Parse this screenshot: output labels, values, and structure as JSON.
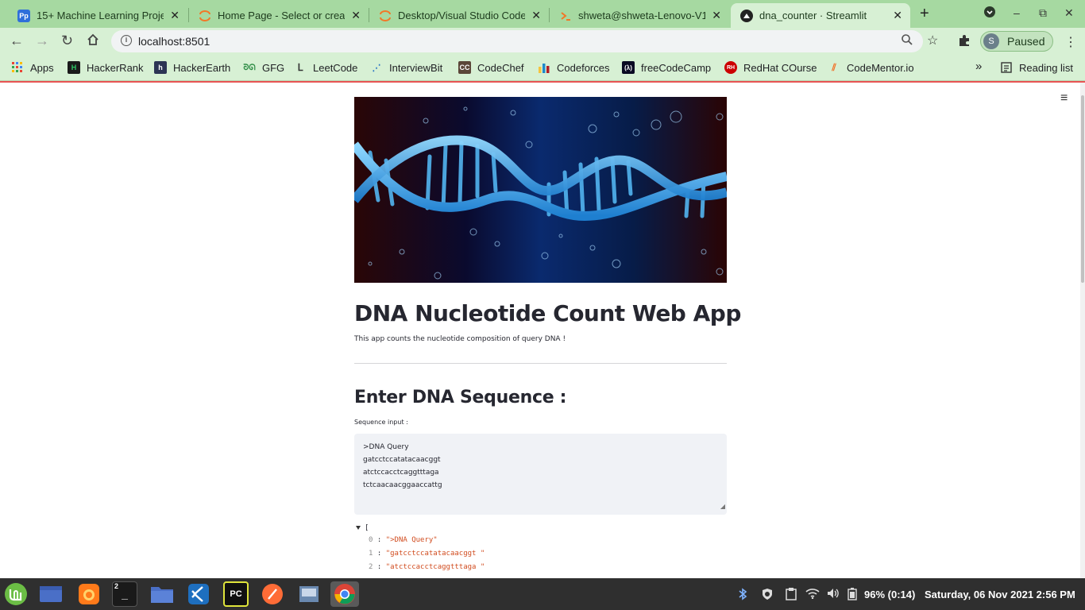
{
  "browser": {
    "tabs": [
      {
        "label": "15+ Machine Learning Proje",
        "favicon": "pp-icon",
        "favicon_text": "Pp",
        "color": "#2f6fda"
      },
      {
        "label": "Home Page - Select or creat",
        "favicon": "jupyter-icon",
        "favicon_text": "",
        "color": "#f37726"
      },
      {
        "label": "Desktop/Visual Studio Code",
        "favicon": "jupyter-icon",
        "favicon_text": "",
        "color": "#f37726"
      },
      {
        "label": "shweta@shweta-Lenovo-V1",
        "favicon": "jupyter-terminal-icon",
        "favicon_text": "",
        "color": "#f37726"
      },
      {
        "label": "dna_counter · Streamlit",
        "favicon": "streamlit-icon",
        "favicon_text": "",
        "color": "#222222"
      }
    ],
    "url": "localhost:8501",
    "profile_initial": "S",
    "profile_label": "Paused",
    "bookmarks": [
      {
        "label": "Apps",
        "icon": "apps-grid-icon"
      },
      {
        "label": "HackerRank",
        "icon": "hackerrank-icon"
      },
      {
        "label": "HackerEarth",
        "icon": "hackerearth-icon"
      },
      {
        "label": "GFG",
        "icon": "gfg-icon"
      },
      {
        "label": "LeetCode",
        "icon": "leetcode-icon"
      },
      {
        "label": "InterviewBit",
        "icon": "interviewbit-icon"
      },
      {
        "label": "CodeChef",
        "icon": "codechef-icon"
      },
      {
        "label": "Codeforces",
        "icon": "codeforces-icon"
      },
      {
        "label": "freeCodeCamp",
        "icon": "freecodecamp-icon"
      },
      {
        "label": "RedHat COurse",
        "icon": "redhat-icon"
      },
      {
        "label": "CodeMentor.io",
        "icon": "codementor-icon"
      }
    ],
    "bookmarks_overflow": "»",
    "reading_list": "Reading list"
  },
  "app": {
    "title": "DNA Nucleotide Count Web App",
    "description": "This app counts the nucleotide composition of query DNA !",
    "section_title": "Enter DNA Sequence :",
    "input_label": "Sequence input :",
    "sequence_lines": [
      ">DNA Query",
      "gatcctccatatacaacggt",
      "atctccacctcaggtttaga",
      "tctcaacaacggaaccattg"
    ],
    "json_bracket": "[",
    "json_items": [
      {
        "index": "0",
        "value": "\">DNA Query\""
      },
      {
        "index": "1",
        "value": "\"gatcctccatatacaacggt \""
      },
      {
        "index": "2",
        "value": "\"atctccacctcaggtttaga \""
      }
    ]
  },
  "taskbar": {
    "apps": [
      {
        "name": "mint-menu-icon",
        "label": "",
        "color": "#6bbd45"
      },
      {
        "name": "show-desktop-icon",
        "label": "",
        "color": "#4a6fc7"
      },
      {
        "name": "firefox-icon",
        "label": "",
        "color": "#ff7a1a"
      },
      {
        "name": "terminal-icon",
        "label": "2",
        "color": "#1a1a1a"
      },
      {
        "name": "files-icon",
        "label": "",
        "color": "#4a6fc7"
      },
      {
        "name": "vscode-icon",
        "label": "",
        "color": "#1e6fbf"
      },
      {
        "name": "pycharm-icon",
        "label": "PC",
        "color": "#111111"
      },
      {
        "name": "postman-icon",
        "label": "",
        "color": "#ff6c37"
      },
      {
        "name": "virtualbox-icon",
        "label": "",
        "color": "#6a89b0"
      },
      {
        "name": "chrome-icon",
        "label": "",
        "color": "#db4437"
      }
    ],
    "battery": "96% (0:14)",
    "datetime": "Saturday, 06 Nov 2021  2:56 PM"
  }
}
